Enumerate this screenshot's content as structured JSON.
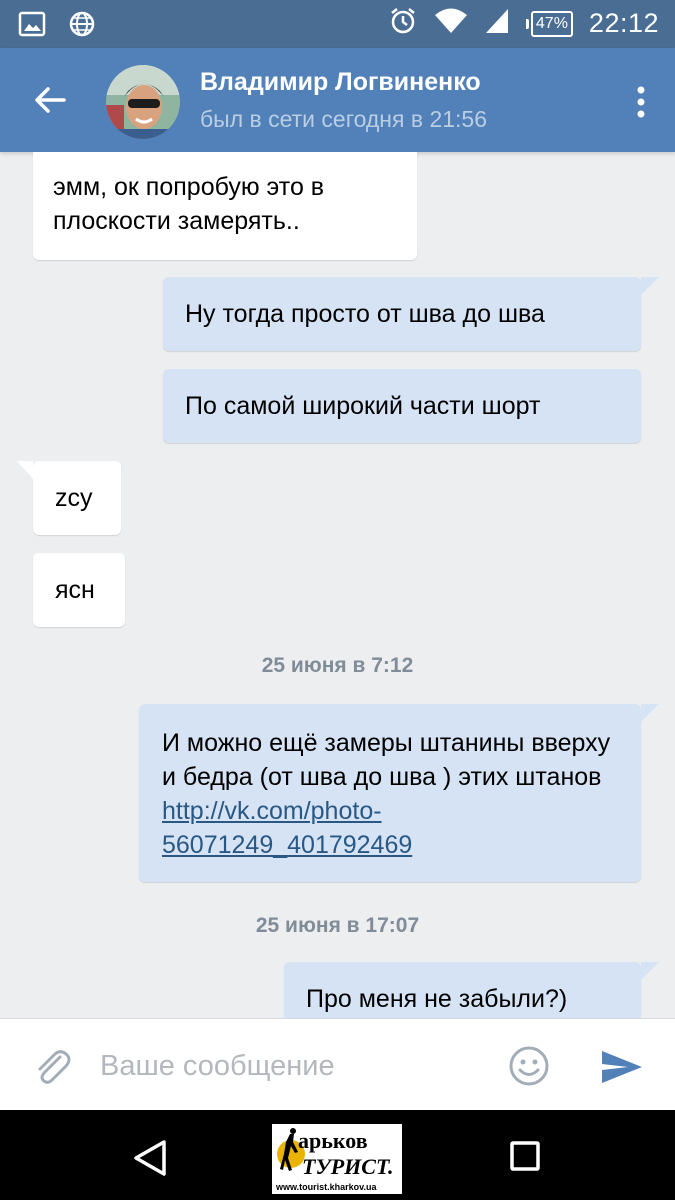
{
  "status_bar": {
    "battery": "47%",
    "time": "22:12"
  },
  "header": {
    "name": "Владимир Логвиненко",
    "status": "был в сети сегодня в 21:56"
  },
  "messages": [
    {
      "direction": "in",
      "text": "эмм, ок попробую это в плоскости замерять.."
    },
    {
      "direction": "out",
      "text": "Ну тогда просто от шва до шва"
    },
    {
      "direction": "out",
      "text": "По самой широкий части шорт"
    },
    {
      "direction": "in",
      "text": "zcy"
    },
    {
      "direction": "in",
      "text": "ясн"
    },
    {
      "date": "25 июня в 7:12"
    },
    {
      "direction": "out",
      "text": "И можно ещё замеры штанины вверху и бедра (от шва до шва ) этих штанов",
      "link": "http://vk.com/photo-56071249_401792469"
    },
    {
      "date": "25 июня в 17:07"
    },
    {
      "direction": "out",
      "text": "Про меня не забыли?)"
    }
  ],
  "composer": {
    "placeholder": "Ваше сообщение"
  },
  "watermark": {
    "line1": "арьков",
    "line2": "ТУРИСТ.",
    "line3": "www.tourist.kharkov.ua"
  },
  "colors": {
    "header": "#5181b8",
    "status_bar": "#4a6d93",
    "incoming": "#ffffff",
    "outgoing": "#d5e3f4",
    "background": "#edeef0",
    "link": "#2a5885"
  }
}
